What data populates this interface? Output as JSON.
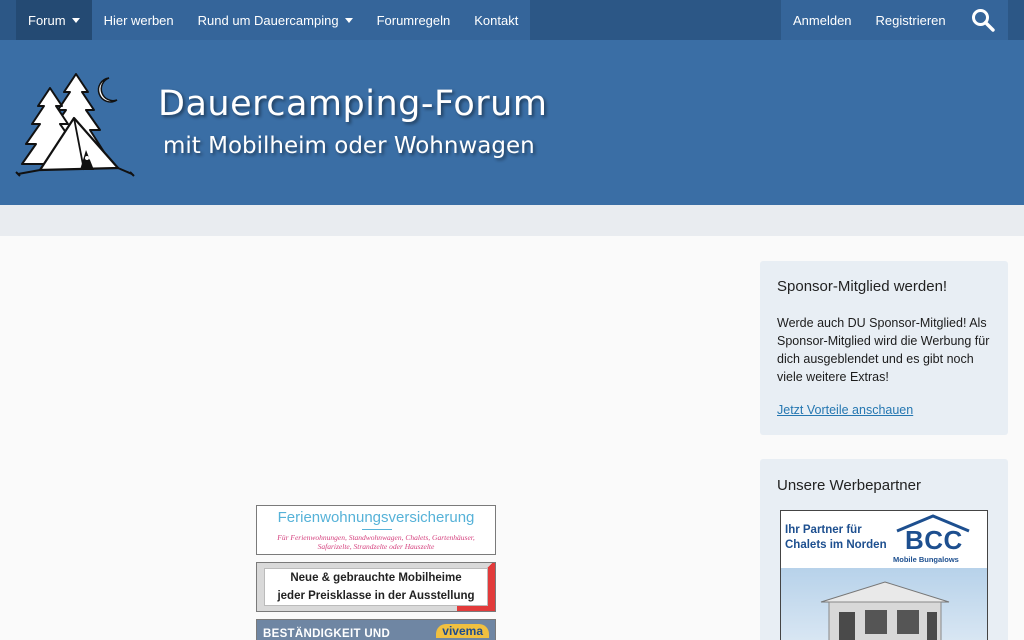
{
  "nav": {
    "items": [
      {
        "label": "Forum",
        "dropdown": true
      },
      {
        "label": "Hier werben",
        "dropdown": false
      },
      {
        "label": "Rund um Dauercamping",
        "dropdown": true
      },
      {
        "label": "Forumregeln",
        "dropdown": false
      },
      {
        "label": "Kontakt",
        "dropdown": false
      }
    ],
    "login_label": "Anmelden",
    "register_label": "Registrieren",
    "search_icon": "search-icon"
  },
  "header": {
    "title": "Dauercamping-Forum",
    "subtitle": "mit Mobilheim oder Wohnwagen"
  },
  "ads": {
    "ad1": {
      "title": "Ferienwohnungsversicherung",
      "subtitle": "Für Ferienwohnungen, Standwohnwagen, Chalets, Gartenhäuser, Safarizelte, Strandzelte oder Hauszelte"
    },
    "ad2": {
      "line1": "Neue & gebrauchte Mobilheime",
      "line2": "jeder Preisklasse in der Ausstellung"
    },
    "ad3": {
      "text": "BESTÄNDIGKEIT UND",
      "logo": "vivema"
    }
  },
  "sidebar": {
    "sponsor": {
      "title": "Sponsor-Mitglied werden!",
      "text": "Werde auch DU Sponsor-Mitglied! Als Sponsor-Mitglied wird die Werbung für dich ausgeblendet und es gibt noch viele weitere Extras!",
      "link": "Jetzt Vorteile anschauen"
    },
    "partners": {
      "title": "Unsere Werbepartner",
      "banner_line1": "Ihr Partner für",
      "banner_line2": "Chalets im Norden",
      "brand": "BCC",
      "brand_sub": "Mobile Bungalows"
    }
  },
  "colors": {
    "nav_bg": "#2c5786",
    "header_bg": "#3a6ea5",
    "block_bg": "#e8eef4",
    "link": "#2577b1"
  }
}
